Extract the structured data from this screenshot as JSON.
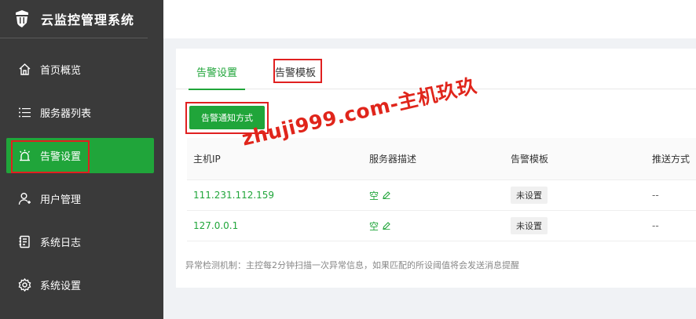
{
  "app": {
    "title": "云监控管理系统"
  },
  "sidebar": {
    "items": [
      {
        "label": "首页概览",
        "icon": "home-icon"
      },
      {
        "label": "服务器列表",
        "icon": "list-icon"
      },
      {
        "label": "告警设置",
        "icon": "alarm-icon",
        "active": true
      },
      {
        "label": "用户管理",
        "icon": "user-icon"
      },
      {
        "label": "系统日志",
        "icon": "log-icon"
      },
      {
        "label": "系统设置",
        "icon": "gear-icon"
      }
    ]
  },
  "tabs": [
    {
      "label": "告警设置",
      "active": true
    },
    {
      "label": "告警模板"
    }
  ],
  "toolbar": {
    "notify_label": "告警通知方式"
  },
  "table": {
    "headers": [
      "主机IP",
      "服务器描述",
      "告警模板",
      "推送方式"
    ],
    "rows": [
      {
        "ip": "111.231.112.159",
        "desc": "空",
        "template": "未设置",
        "push": "--"
      },
      {
        "ip": "127.0.0.1",
        "desc": "空",
        "template": "未设置",
        "push": "--"
      }
    ]
  },
  "note": "异常检测机制：主控每2分钟扫描一次异常信息，如果匹配的所设阈值将会发送消息提醒",
  "watermark": "zhuji999.com-主机玖玖",
  "colors": {
    "accent": "#20a53a",
    "sidebar": "#3a3a3a",
    "highlight": "#e02020"
  }
}
